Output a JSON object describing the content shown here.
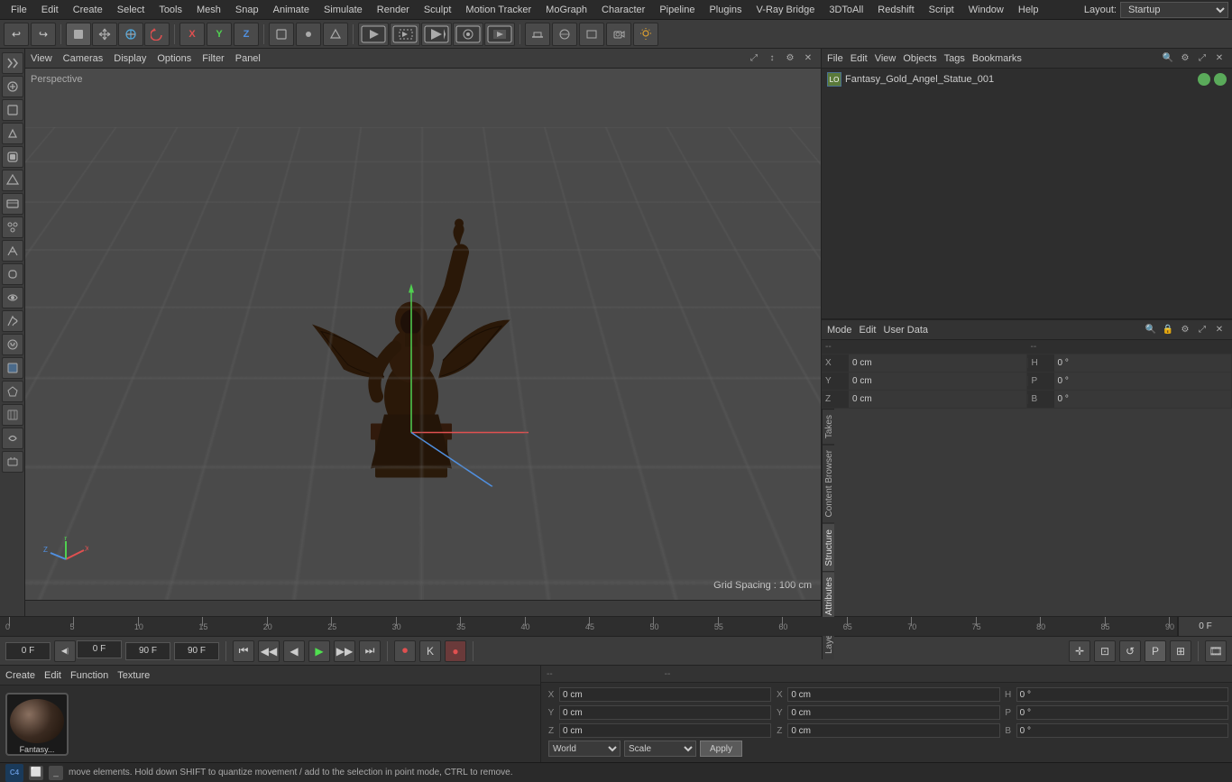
{
  "app": {
    "title": "Cinema 4D"
  },
  "menubar": {
    "items": [
      "File",
      "Edit",
      "Create",
      "Select",
      "Tools",
      "Mesh",
      "Snap",
      "Animate",
      "Simulate",
      "Render",
      "Sculpt",
      "Motion Tracker",
      "MoGraph",
      "Character",
      "Pipeline",
      "Plugins",
      "V-Ray Bridge",
      "3DToAll",
      "Redshift",
      "Script",
      "Window",
      "Help"
    ],
    "layout_label": "Layout:",
    "layout_value": "Startup"
  },
  "viewport": {
    "camera_mode": "Perspective",
    "grid_spacing": "Grid Spacing : 100 cm",
    "menus": [
      "View",
      "Cameras",
      "Display",
      "Options",
      "Filter",
      "Panel"
    ]
  },
  "objects_panel": {
    "menus": [
      "File",
      "Edit",
      "View",
      "Objects",
      "Tags",
      "Bookmarks"
    ],
    "object_name": "Fantasy_Gold_Angel_Statue_001",
    "icons": [
      "≡",
      "⊞",
      "◈"
    ]
  },
  "attributes_panel": {
    "menus": [
      "Mode",
      "Edit",
      "User Data"
    ],
    "coords": {
      "x_pos": "0 cm",
      "y_pos": "0 cm",
      "z_pos": "0 cm",
      "x_size": "0 °",
      "y_size": "0 °",
      "z_size": "0 °",
      "x_scale": "--",
      "y_scale": "--",
      "z_scale": "--",
      "h": "0 °",
      "p": "0 °",
      "b": "0 °"
    }
  },
  "timeline": {
    "markers": [
      0,
      5,
      10,
      15,
      20,
      25,
      30,
      35,
      40,
      45,
      50,
      55,
      60,
      65,
      70,
      75,
      80,
      85,
      90
    ],
    "current_frame": "0 F"
  },
  "transport": {
    "start_frame": "0 F",
    "end_frame": "90 F",
    "current_frame_input": "0 F",
    "end_frame_2": "90 F"
  },
  "material": {
    "menus": [
      "Create",
      "Edit",
      "Function",
      "Texture"
    ],
    "swatch_label": "Fantasy..."
  },
  "coord_panel": {
    "labels": [
      "--",
      "--"
    ],
    "x_pos": "0 cm",
    "y_pos": "0 cm",
    "z_pos": "0 cm",
    "x_size": "0 cm",
    "y_size": "0 cm",
    "z_size": "0 cm",
    "h_val": "0 °",
    "p_val": "0 °",
    "b_val": "0 °",
    "world_label": "World",
    "scale_label": "Scale",
    "apply_label": "Apply"
  },
  "status_bar": {
    "message": "move elements. Hold down SHIFT to quantize movement / add to the selection in point mode, CTRL to remove."
  },
  "right_tabs": [
    "Takes",
    "Content Browser",
    "Structure",
    "Attributes",
    "Layers"
  ],
  "icons": {
    "undo": "↩",
    "redo": "↪",
    "move": "✛",
    "scale": "⊞",
    "rotate": "↺",
    "model": "◼",
    "polygon": "△",
    "point": "·",
    "edge": "—",
    "live": "⬡",
    "render": "▶",
    "render_region": "▷",
    "render_active": "▶",
    "play": "▶",
    "prev": "◀",
    "next": "▶",
    "first": "⏮",
    "last": "⏭",
    "record": "⏺",
    "loop": "🔁",
    "stop": "⏹"
  }
}
